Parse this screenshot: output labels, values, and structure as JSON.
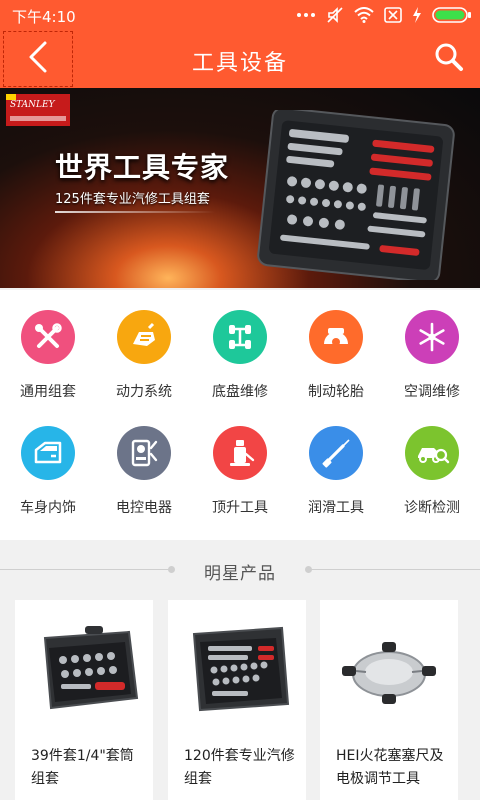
{
  "status_bar": {
    "time": "下午4:10",
    "icons": [
      "more-dots-icon",
      "mute-icon",
      "wifi-icon",
      "no-sim-icon",
      "charging-icon",
      "battery-icon"
    ]
  },
  "header": {
    "title": "工具设备",
    "back_icon": "back-arrow-icon",
    "search_icon": "search-icon"
  },
  "banner": {
    "brand": "STANLEY",
    "headline": "世界工具专家",
    "subline": "125件套专业汽修工具组套"
  },
  "categories": [
    {
      "label": "通用组套",
      "color": "#f0507e",
      "icon": "tools-cross-icon"
    },
    {
      "label": "动力系统",
      "color": "#f8a70f",
      "icon": "engine-icon"
    },
    {
      "label": "底盘维修",
      "color": "#1ec89a",
      "icon": "chassis-icon"
    },
    {
      "label": "制动轮胎",
      "color": "#ff6b2b",
      "icon": "brake-icon"
    },
    {
      "label": "空调维修",
      "color": "#cc3fb8",
      "icon": "snowflake-icon"
    },
    {
      "label": "车身内饰",
      "color": "#27b5e8",
      "icon": "car-door-icon"
    },
    {
      "label": "电控电器",
      "color": "#6c7489",
      "icon": "electric-device-icon"
    },
    {
      "label": "顶升工具",
      "color": "#f24545",
      "icon": "jack-icon"
    },
    {
      "label": "润滑工具",
      "color": "#3a8ee8",
      "icon": "grease-gun-icon"
    },
    {
      "label": "诊断检测",
      "color": "#7cc42e",
      "icon": "car-diagnosis-icon"
    }
  ],
  "section": {
    "title": "明星产品"
  },
  "products": [
    {
      "name": "39件套1/4\"套筒组套"
    },
    {
      "name": "120件套专业汽修组套"
    },
    {
      "name": "HEI火花塞塞尺及电极调节工具"
    }
  ],
  "colors": {
    "brand": "#ff5a30",
    "background": "#f1f1f1"
  }
}
